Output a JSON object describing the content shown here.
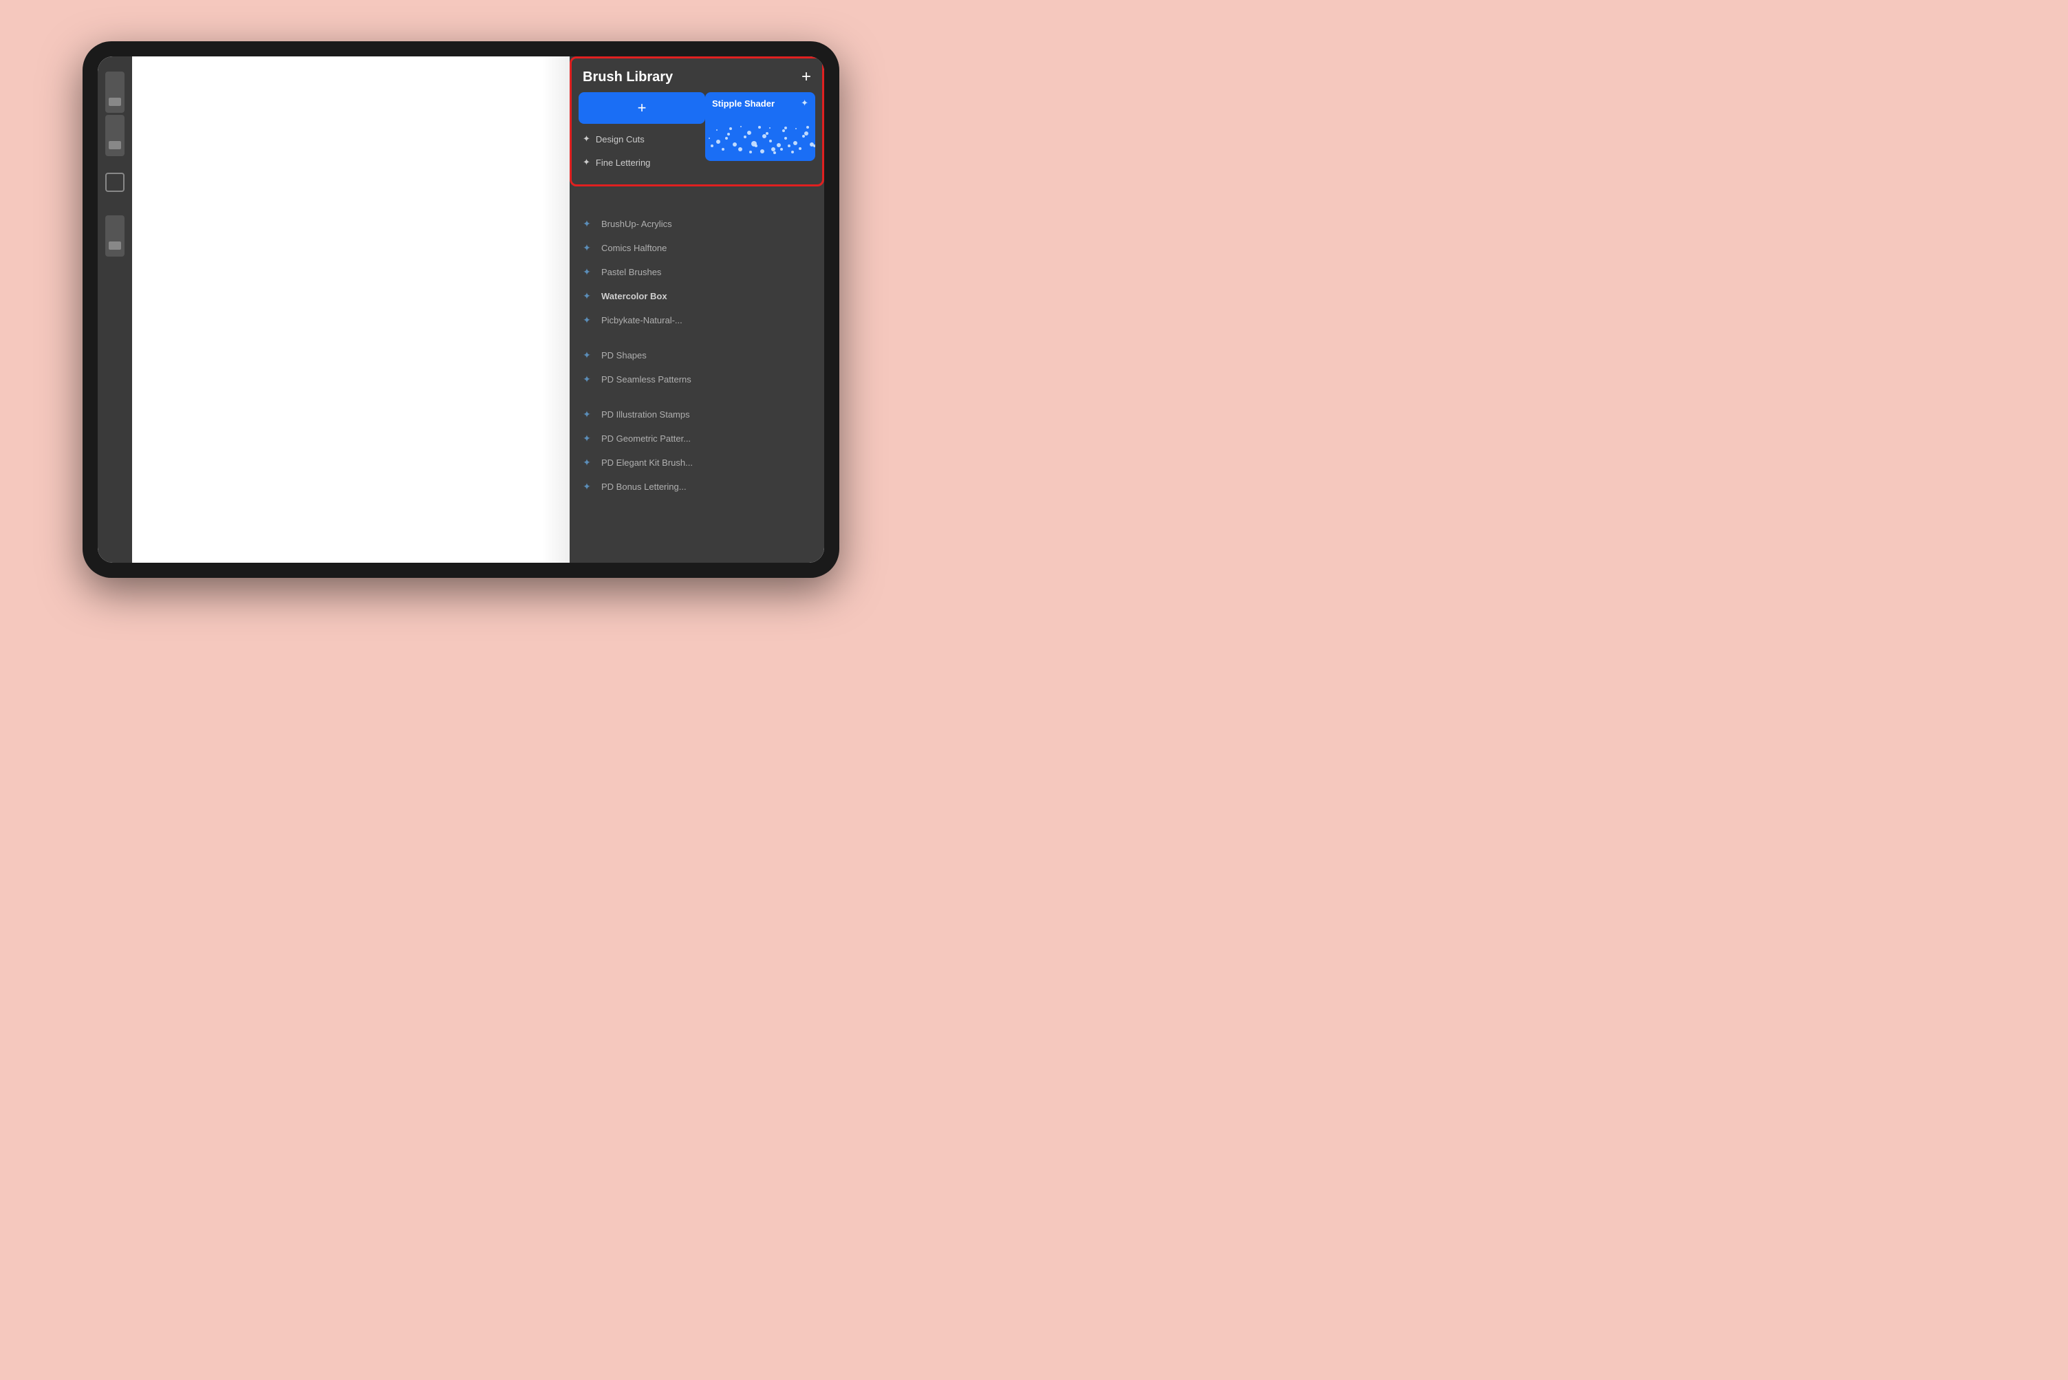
{
  "tablet": {
    "background": "#f5c8be"
  },
  "brushLibrary": {
    "title": "Brush Library",
    "addButtonLabel": "+",
    "selectedBrush": {
      "name": "Stipple Shader",
      "icon": "✦"
    },
    "popupItems": [
      {
        "id": "design-cuts",
        "label": "Design Cuts"
      },
      {
        "id": "fine-lettering",
        "label": "Fine Lettering"
      }
    ]
  },
  "brushList": {
    "items": [
      {
        "id": "brushup-acrylics",
        "label": "BrushUp- Acrylics",
        "bold": false
      },
      {
        "id": "comics-halftone",
        "label": "Comics Halftone",
        "bold": false
      },
      {
        "id": "pastel-brushes",
        "label": "Pastel Brushes",
        "bold": false
      },
      {
        "id": "watercolor-box",
        "label": "Watercolor Box",
        "bold": true
      },
      {
        "id": "picbykate",
        "label": "Picbykate-Natural-...",
        "bold": false
      },
      {
        "id": "spacer1",
        "label": "",
        "spacer": true
      },
      {
        "id": "pd-shapes",
        "label": "PD Shapes",
        "bold": false
      },
      {
        "id": "pd-seamless",
        "label": "PD Seamless Patterns",
        "bold": false
      },
      {
        "id": "spacer2",
        "label": "",
        "spacer": true
      },
      {
        "id": "pd-illustration",
        "label": "PD Illustration Stamps",
        "bold": false
      },
      {
        "id": "pd-geometric",
        "label": "PD Geometric Patter...",
        "bold": false
      },
      {
        "id": "pd-elegant",
        "label": "PD Elegant Kit Brush...",
        "bold": false
      },
      {
        "id": "pd-bonus",
        "label": "PD Bonus Lettering...",
        "bold": false
      }
    ]
  }
}
